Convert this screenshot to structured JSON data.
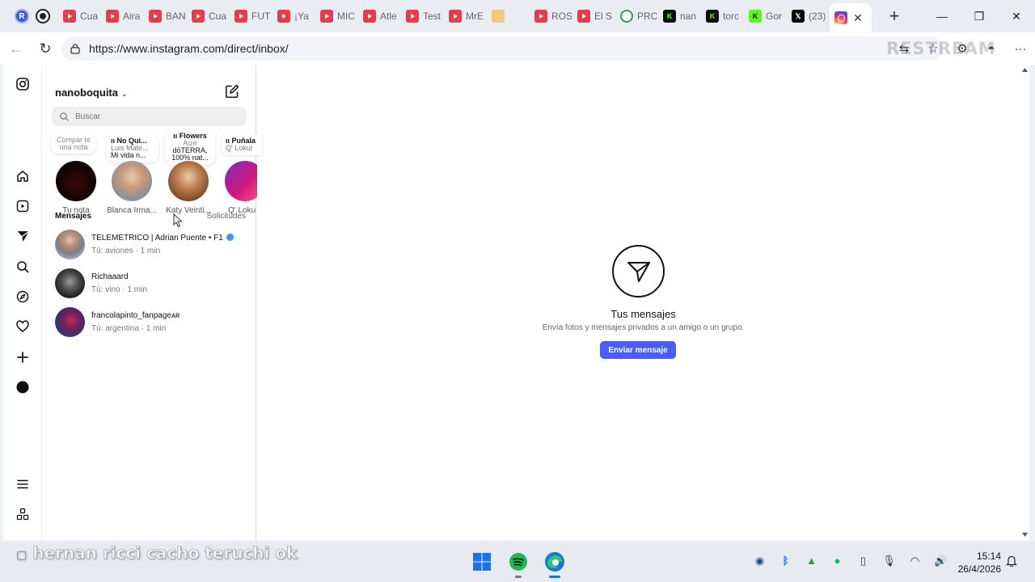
{
  "browser": {
    "tabs": [
      {
        "label": "Cua",
        "icon": "youtube-icon"
      },
      {
        "label": "Aira",
        "icon": "youtube-icon"
      },
      {
        "label": "BAN",
        "icon": "youtube-icon"
      },
      {
        "label": "Cua",
        "icon": "youtube-icon"
      },
      {
        "label": "FUT",
        "icon": "youtube-icon"
      },
      {
        "label": "¡Ya",
        "icon": "youtube-icon"
      },
      {
        "label": "MIC",
        "icon": "youtube-icon"
      },
      {
        "label": "Atle",
        "icon": "youtube-icon"
      },
      {
        "label": "Test",
        "icon": "youtube-icon"
      },
      {
        "label": "MrE",
        "icon": "youtube-icon"
      },
      {
        "label": "",
        "icon": "lock-icon"
      },
      {
        "label": "ROS",
        "icon": "youtube-icon"
      },
      {
        "label": "El S",
        "icon": "youtube-icon"
      },
      {
        "label": "PRC",
        "icon": "soccer-ball-icon"
      },
      {
        "label": "nan",
        "icon": "kick-icon"
      },
      {
        "label": "torc",
        "icon": "kick-icon"
      },
      {
        "label": "Gor",
        "icon": "kick-icon"
      },
      {
        "label": "(23)",
        "icon": "x-icon"
      }
    ],
    "active_tab_icon": "instagram-icon",
    "url": "https://www.instagram.com/direct/inbox/",
    "watermark": "RESTREAM"
  },
  "inbox": {
    "username": "nanoboquita",
    "search_placeholder": "Buscar",
    "own_note": "Compar te una nota",
    "notes": [
      {
        "title": "No Qui...",
        "line1": "Luis Mate...",
        "line2": "Mi vida n..."
      },
      {
        "title": "Flowers",
        "line1": "Aize",
        "line2": "dōTERRA, 100% nat..."
      },
      {
        "title": "Puñala",
        "line1": "Q' Lokur",
        "line2": ""
      }
    ],
    "stories": [
      "Tu nota",
      "Blanca Irma...",
      "Katy Veinti...",
      "Q' Loku"
    ],
    "messages_label": "Mensajes",
    "requests_label": "Solicitudes",
    "conversations": [
      {
        "name": "TELEMETRICO | Adrian Puente • F1",
        "snippet": "Tú: aviones · 1 min",
        "verified": true
      },
      {
        "name": "Richaaard",
        "snippet": "Tú: vino · 1 min",
        "verified": false
      },
      {
        "name": "francolapinto_fanpageᴀʀ",
        "snippet": "Tú: argentina · 1 min",
        "verified": false
      }
    ]
  },
  "main": {
    "title": "Tus mensajes",
    "subtitle": "Envía fotos y mensajes privados a un amigo o un grupo.",
    "button": "Enviar mensaje"
  },
  "overlay_caption": "hernan ricci cacho teruchi ok",
  "taskbar": {
    "time": "15:14",
    "date": "26/4/2026"
  },
  "colors": {
    "accent": "#4a5df9",
    "verified": "#3897f0",
    "youtube": "#e53c4c",
    "kick": "#53fc18"
  }
}
